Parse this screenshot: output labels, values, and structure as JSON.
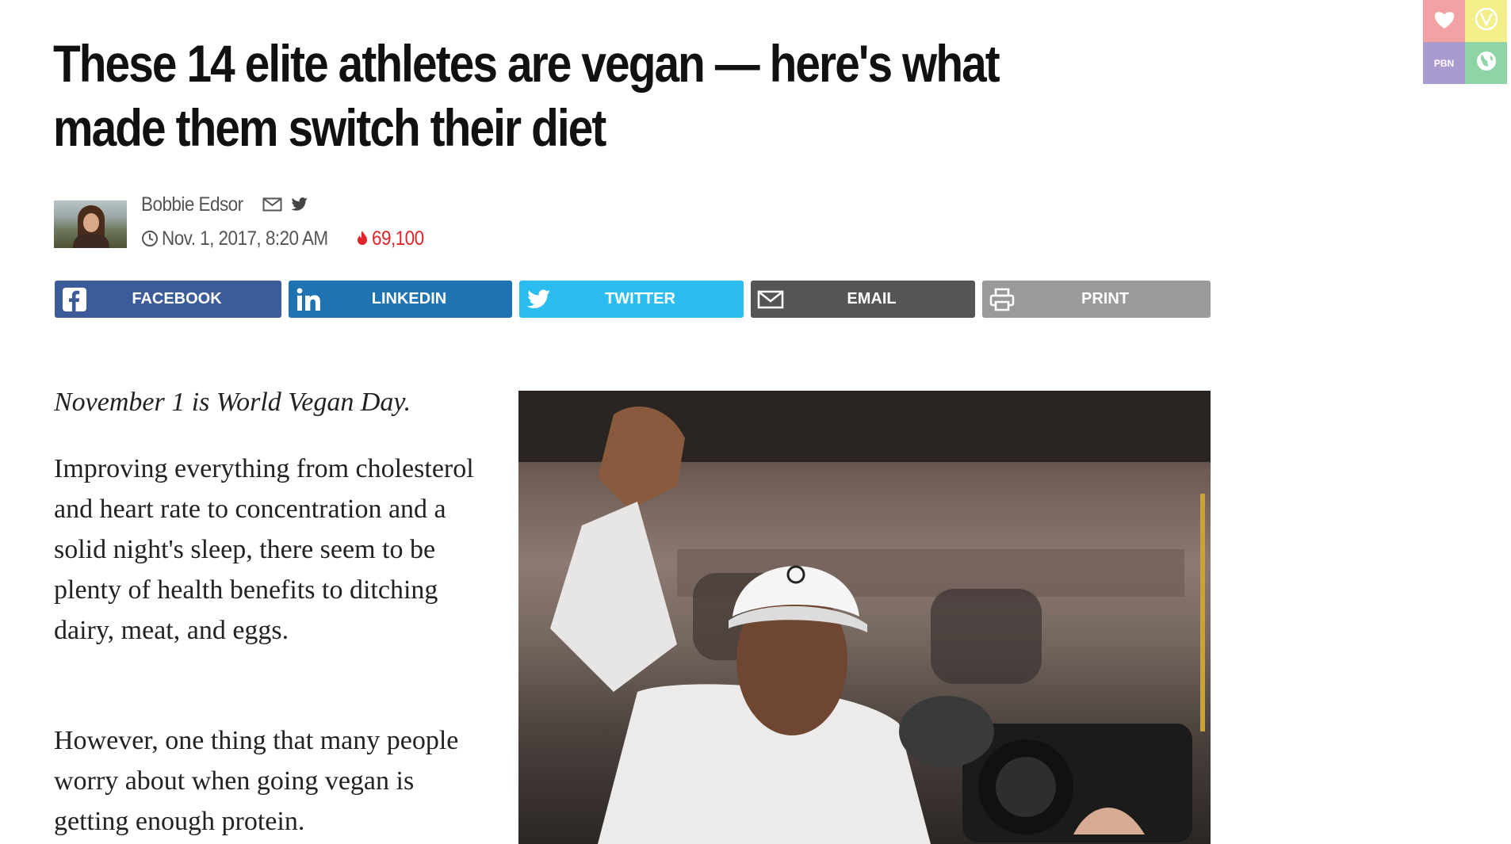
{
  "article": {
    "headline": "These 14 elite athletes are vegan — here's what made them switch their diet",
    "author": "Bobbie Edsor",
    "date": "Nov. 1, 2017, 8:20 AM",
    "views": "69,100"
  },
  "share_buttons": [
    {
      "label": "FACEBOOK",
      "icon": "facebook-icon",
      "color": "#3b5b99"
    },
    {
      "label": "LINKEDIN",
      "icon": "linkedin-icon",
      "color": "#1f73b3"
    },
    {
      "label": "TWITTER",
      "icon": "twitter-icon",
      "color": "#2cbdf0"
    },
    {
      "label": "EMAIL",
      "icon": "mail-icon",
      "color": "#555555"
    },
    {
      "label": "PRINT",
      "icon": "printer-icon",
      "color": "#9a9a9a"
    }
  ],
  "body": {
    "lead": "November 1 is World Vegan Day.",
    "paragraphs": [
      "Improving everything from cholesterol and heart rate to concentration and a solid night's sleep, there seem to be plenty of health benefits to ditching dairy, meat, and eggs.",
      "However, one thing that many people worry about when going vegan is getting enough protein."
    ]
  },
  "corner_tiles": {
    "pbn_label": "PBN",
    "colors": [
      "#f2a2a2",
      "#f2ef8a",
      "#a79bd0",
      "#8fd3a6"
    ]
  },
  "colors": {
    "views_accent": "#e2232a"
  }
}
